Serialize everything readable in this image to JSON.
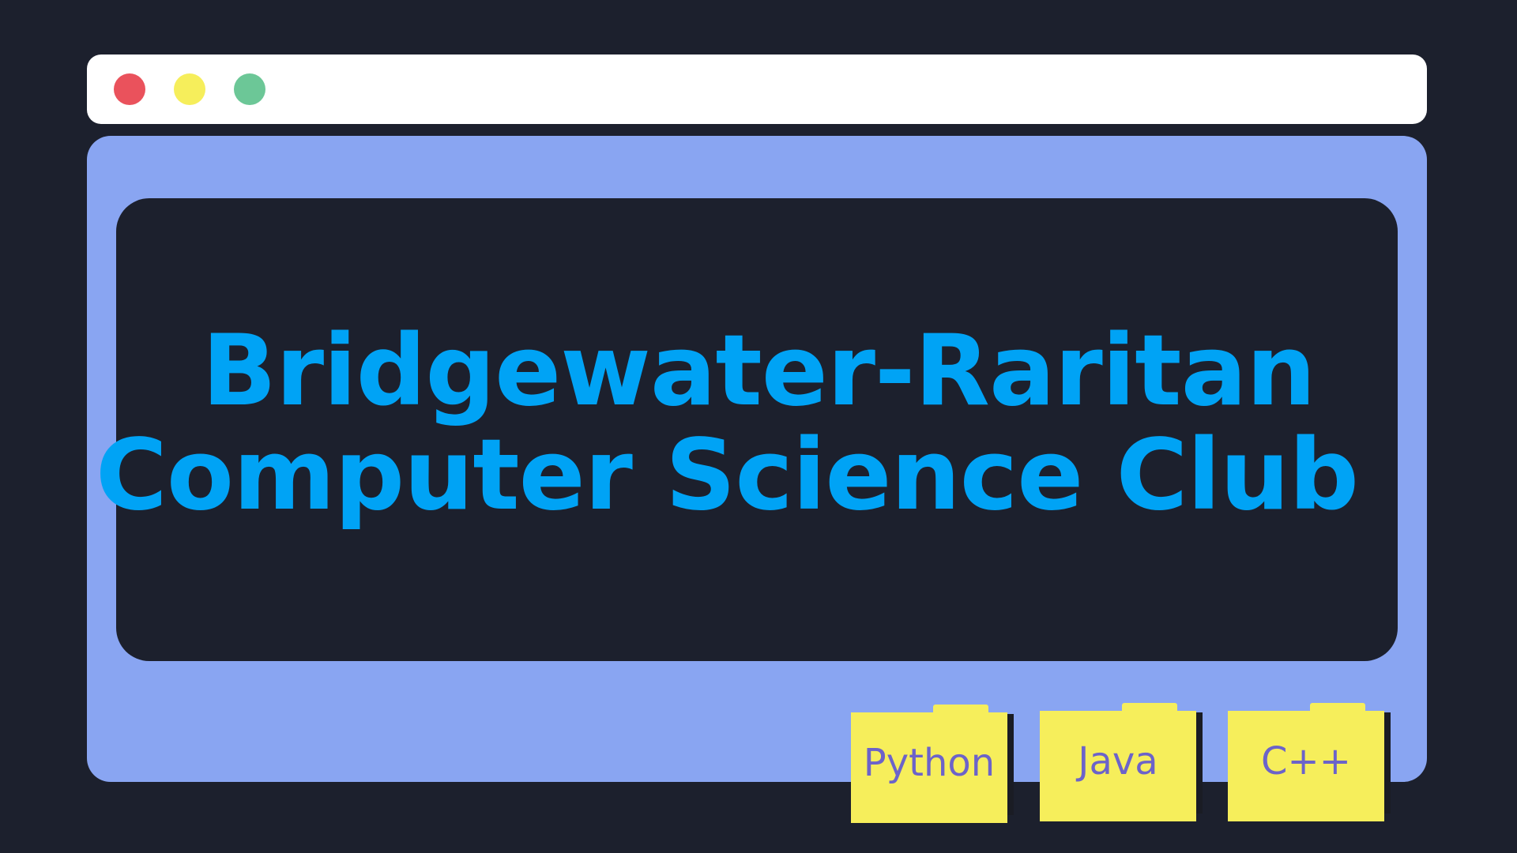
{
  "window": {
    "controls": [
      {
        "name": "close",
        "color": "#ea525c"
      },
      {
        "name": "minimize",
        "color": "#f6ee5b"
      },
      {
        "name": "maximize",
        "color": "#6cc797"
      }
    ]
  },
  "hero": {
    "line1": "Bridgewater-Raritan",
    "line2": "Computer Science Club"
  },
  "folders": [
    {
      "label": "Python"
    },
    {
      "label": "Java"
    },
    {
      "label": "C++"
    }
  ],
  "colors": {
    "background": "#1c202d",
    "titlebar": "#ffffff",
    "window_body": "#89a5f2",
    "screen": "#1c202d",
    "title_text": "#00a3f5",
    "folder": "#f6ee5b",
    "folder_text": "#6c63c9"
  }
}
